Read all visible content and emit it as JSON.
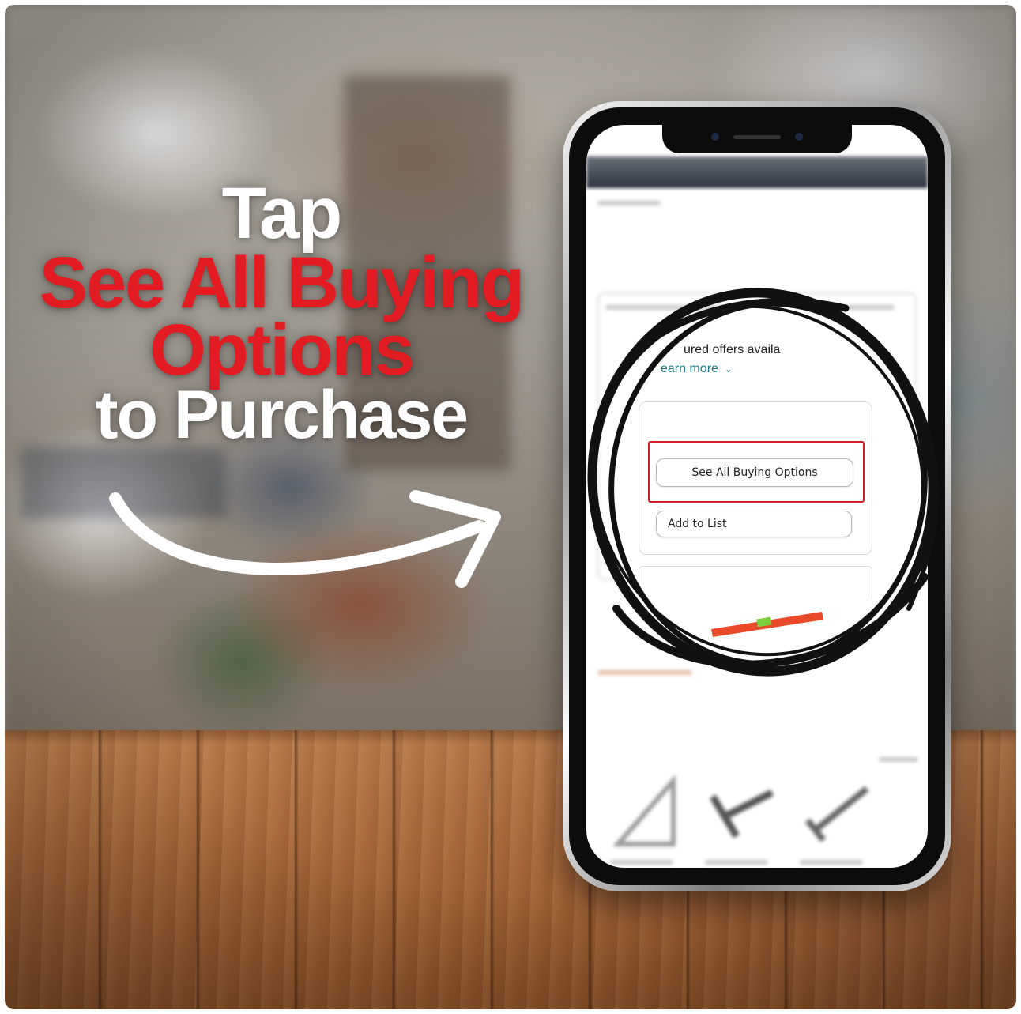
{
  "headline": {
    "line1": "Tap",
    "line2": "See All Buying",
    "line3": "Options",
    "line4": "to Purchase"
  },
  "colors": {
    "accent_red": "#e31b23",
    "headline_white": "#ffffff",
    "highlight_red": "#d0202a",
    "link_teal": "#1c7e8a"
  },
  "screen": {
    "offers_text": "ured offers availa",
    "learn_more": "earn more",
    "chevron": "chevron-down-icon",
    "buy_options_button": "See All Buying Options",
    "add_to_list_button": "Add to List"
  }
}
